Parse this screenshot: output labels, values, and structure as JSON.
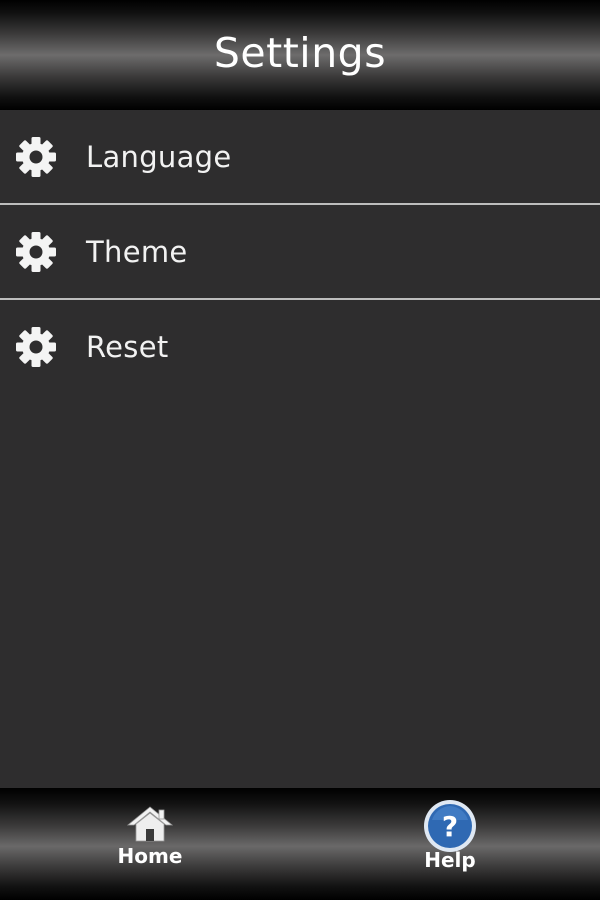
{
  "header": {
    "title": "Settings"
  },
  "settings": {
    "items": [
      {
        "label": "Language",
        "icon": "gear-icon"
      },
      {
        "label": "Theme",
        "icon": "gear-icon"
      },
      {
        "label": "Reset",
        "icon": "gear-icon"
      }
    ]
  },
  "tabbar": {
    "tabs": [
      {
        "label": "Home",
        "icon": "home-icon"
      },
      {
        "label": "Help",
        "icon": "help-icon"
      }
    ]
  },
  "colors": {
    "background": "#2e2d2e",
    "divider": "#bdbdbd",
    "text": "#f2f2f2",
    "help_accent": "#2f69b3"
  }
}
